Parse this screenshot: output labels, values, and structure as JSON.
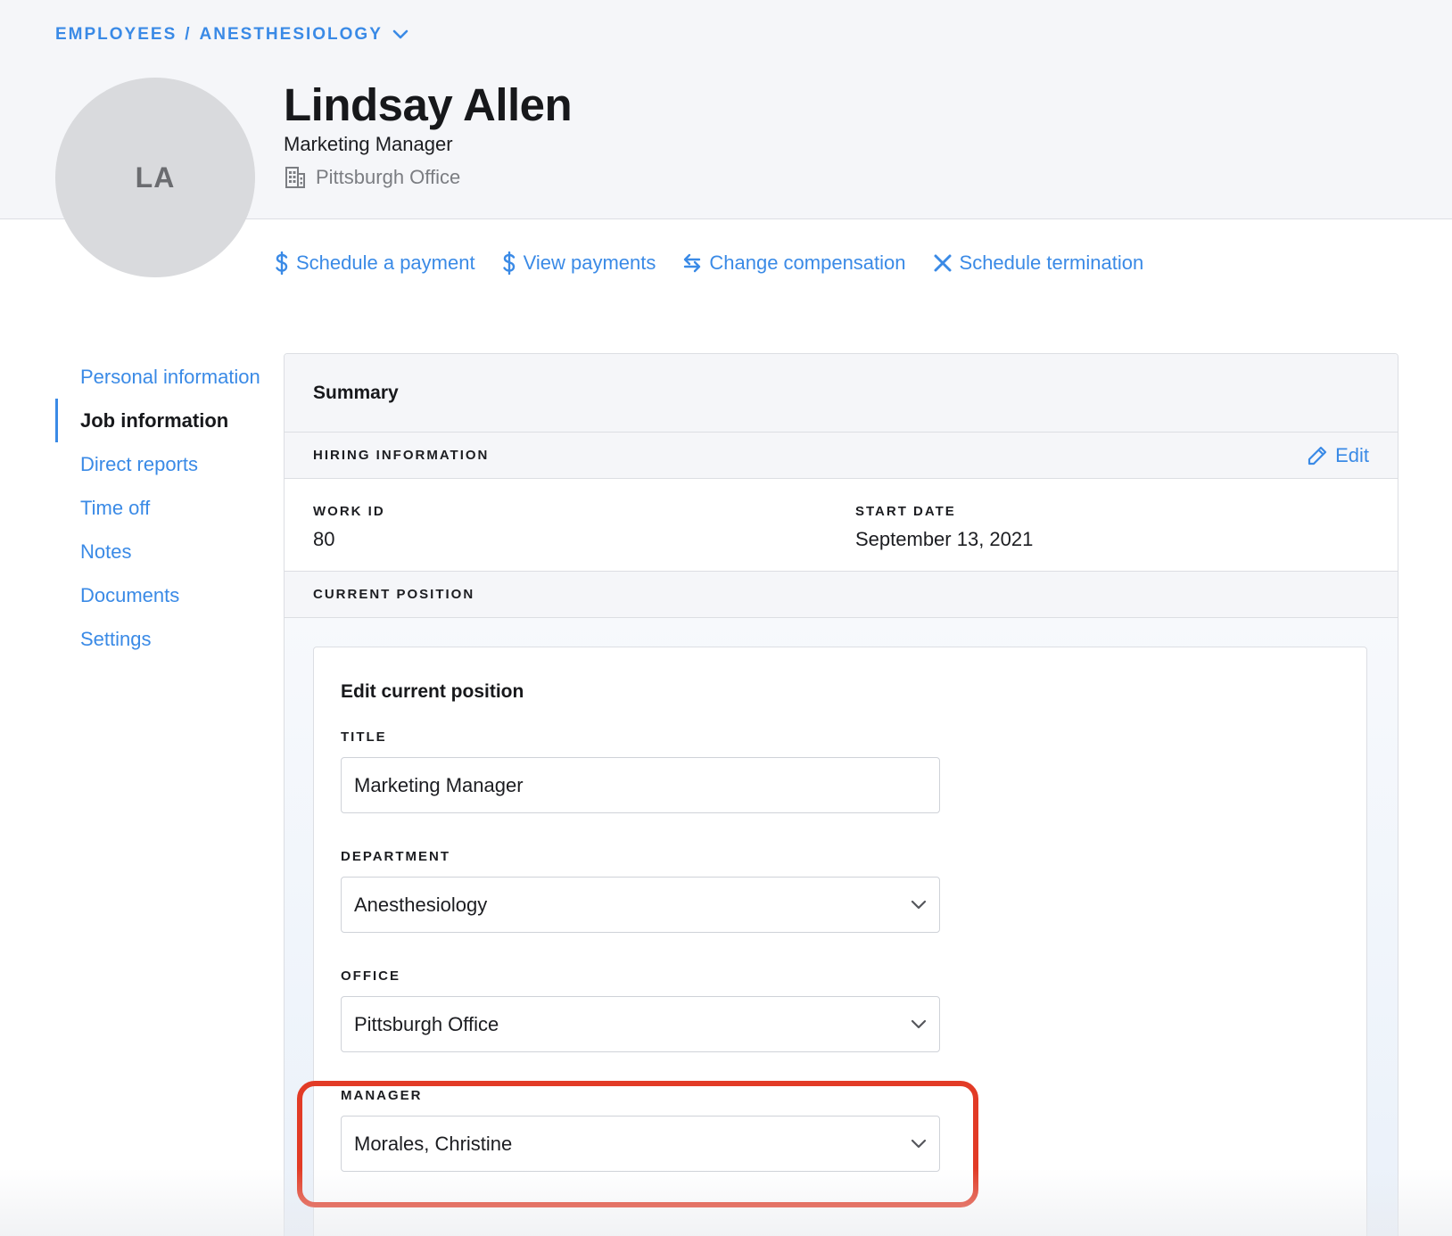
{
  "breadcrumb": {
    "root": "EMPLOYEES",
    "separator": "/",
    "current": "ANESTHESIOLOGY"
  },
  "employee": {
    "initials": "LA",
    "name": "Lindsay Allen",
    "title": "Marketing Manager",
    "office": "Pittsburgh Office"
  },
  "actions": [
    {
      "label": "Schedule a payment",
      "icon": "dollar-icon"
    },
    {
      "label": "View payments",
      "icon": "dollar-icon"
    },
    {
      "label": "Change compensation",
      "icon": "swap-arrows-icon"
    },
    {
      "label": "Schedule termination",
      "icon": "close-icon"
    }
  ],
  "sidenav": [
    {
      "label": "Personal information",
      "active": false
    },
    {
      "label": "Job information",
      "active": true
    },
    {
      "label": "Direct reports",
      "active": false
    },
    {
      "label": "Time off",
      "active": false
    },
    {
      "label": "Notes",
      "active": false
    },
    {
      "label": "Documents",
      "active": false
    },
    {
      "label": "Settings",
      "active": false
    }
  ],
  "summary": {
    "title": "Summary",
    "hiring": {
      "label": "HIRING INFORMATION",
      "edit_label": "Edit",
      "work_id_label": "WORK ID",
      "work_id": "80",
      "start_date_label": "START DATE",
      "start_date": "September 13, 2021"
    },
    "current_position": {
      "label": "CURRENT POSITION",
      "panel_title": "Edit current position",
      "title_label": "TITLE",
      "title_value": "Marketing Manager",
      "department_label": "DEPARTMENT",
      "department_value": "Anesthesiology",
      "office_label": "OFFICE",
      "office_value": "Pittsburgh Office",
      "manager_label": "MANAGER",
      "manager_value": "Morales, Christine"
    }
  },
  "colors": {
    "accent": "#3a8ae6",
    "highlight": "#e23b26",
    "header_bg": "#f5f6f9"
  }
}
